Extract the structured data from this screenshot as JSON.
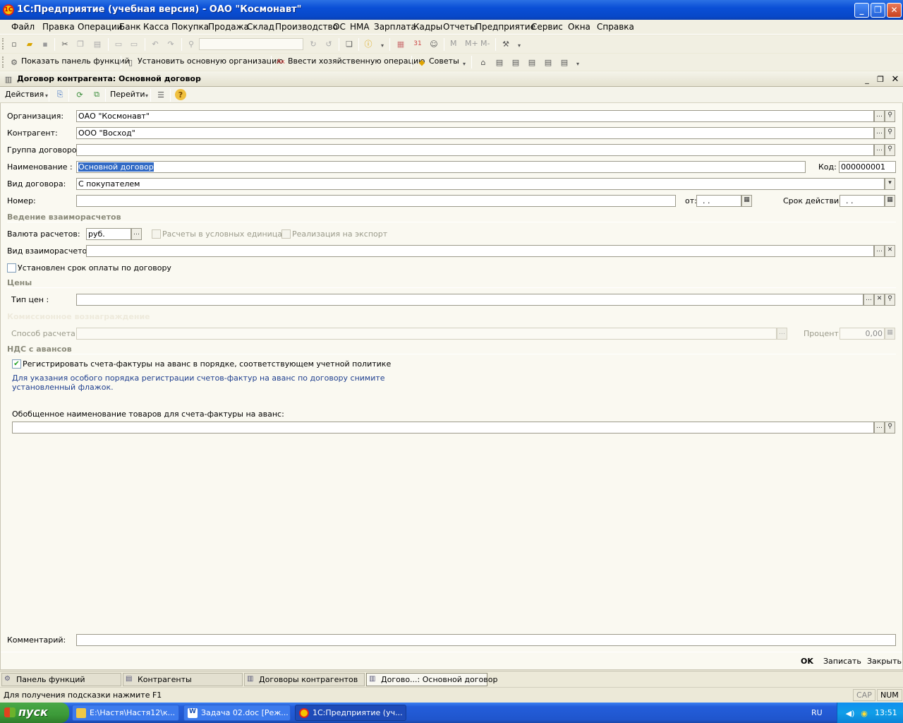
{
  "app": {
    "title": "1С:Предприятие (учебная версия) - ОАО \"Космонавт\""
  },
  "menu": [
    "Файл",
    "Правка",
    "Операции",
    "Банк",
    "Касса",
    "Покупка",
    "Продажа",
    "Склад",
    "Производство",
    "ОС",
    "НМА",
    "Зарплата",
    "Кадры",
    "Отчеты",
    "Предприятие",
    "Сервис",
    "Окна",
    "Справка"
  ],
  "toolbar2": {
    "show_panel": "Показать панель функций",
    "set_org": "Установить основную организацию",
    "enter_op": "Ввести хозяйственную операцию",
    "tips": "Советы",
    "m_labels": [
      "M",
      "M+",
      "M-"
    ]
  },
  "doc": {
    "title": "Договор контрагента: Основной договор",
    "actions": "Действия",
    "goto": "Перейти",
    "fields": {
      "org_label": "Организация:",
      "org_value": "ОАО \"Космонавт\"",
      "contr_label": "Контрагент:",
      "contr_value": "ООО \"Восход\"",
      "group_label": "Группа договоров:",
      "group_value": "",
      "name_label": "Наименование :",
      "name_value": "Основной договор",
      "code_label": "Код:",
      "code_value": "000000001",
      "kind_label": "Вид договора:",
      "kind_value": "С покупателем",
      "num_label": "Номер:",
      "num_value": "",
      "from_label": "от:",
      "from_value": ". .",
      "term_label": "Срок действия:",
      "term_value": ". ."
    },
    "settlements": {
      "section": "Ведение взаиморасчетов",
      "currency_label": "Валюта расчетов:",
      "currency_value": "руб.",
      "conv_units": "Расчеты в условных единицах",
      "export": "Реализация на экспорт",
      "kind_label": "Вид взаиморасчетов:",
      "kind_value": "",
      "payment_term": "Установлен срок оплаты по договору"
    },
    "prices": {
      "section": "Цены",
      "type_label": "Тип цен :",
      "type_value": ""
    },
    "commission": {
      "section": "Комиссионное вознаграждение",
      "method_label": "Способ расчета:",
      "method_value": "",
      "percent_label": "Процент:",
      "percent_value": "0,00"
    },
    "vat": {
      "section": "НДС с авансов",
      "register": "Регистрировать счета-фактуры на аванс в порядке, соответствующем учетной политике",
      "hint1": "Для указания особого порядка регистрации счетов-фактур на аванс по договору снимите",
      "hint2": "установленный флажок.",
      "generic_label": "Обобщенное наименование товаров для счета-фактуры на аванс:",
      "generic_value": ""
    },
    "comment_label": "Комментарий:",
    "comment_value": "",
    "buttons": {
      "ok": "OK",
      "save": "Записать",
      "close": "Закрыть"
    }
  },
  "tabs": [
    "Панель функций",
    "Контрагенты",
    "Договоры контрагентов",
    "Догово...: Основной договор"
  ],
  "status": {
    "hint": "Для получения подсказки нажмите F1",
    "cap": "CAP",
    "num": "NUM"
  },
  "taskbar": {
    "start": "пуск",
    "tasks": [
      "E:\\Настя\\Настя12\\к...",
      "Задача 02.doc [Реж...",
      "1С:Предприятие (уч..."
    ],
    "lang": "RU",
    "time": "13:51"
  },
  "colors": {
    "accent": "#0a4fd6",
    "hint_text": "#1f3f8f",
    "section_text": "#8a8a7a"
  }
}
